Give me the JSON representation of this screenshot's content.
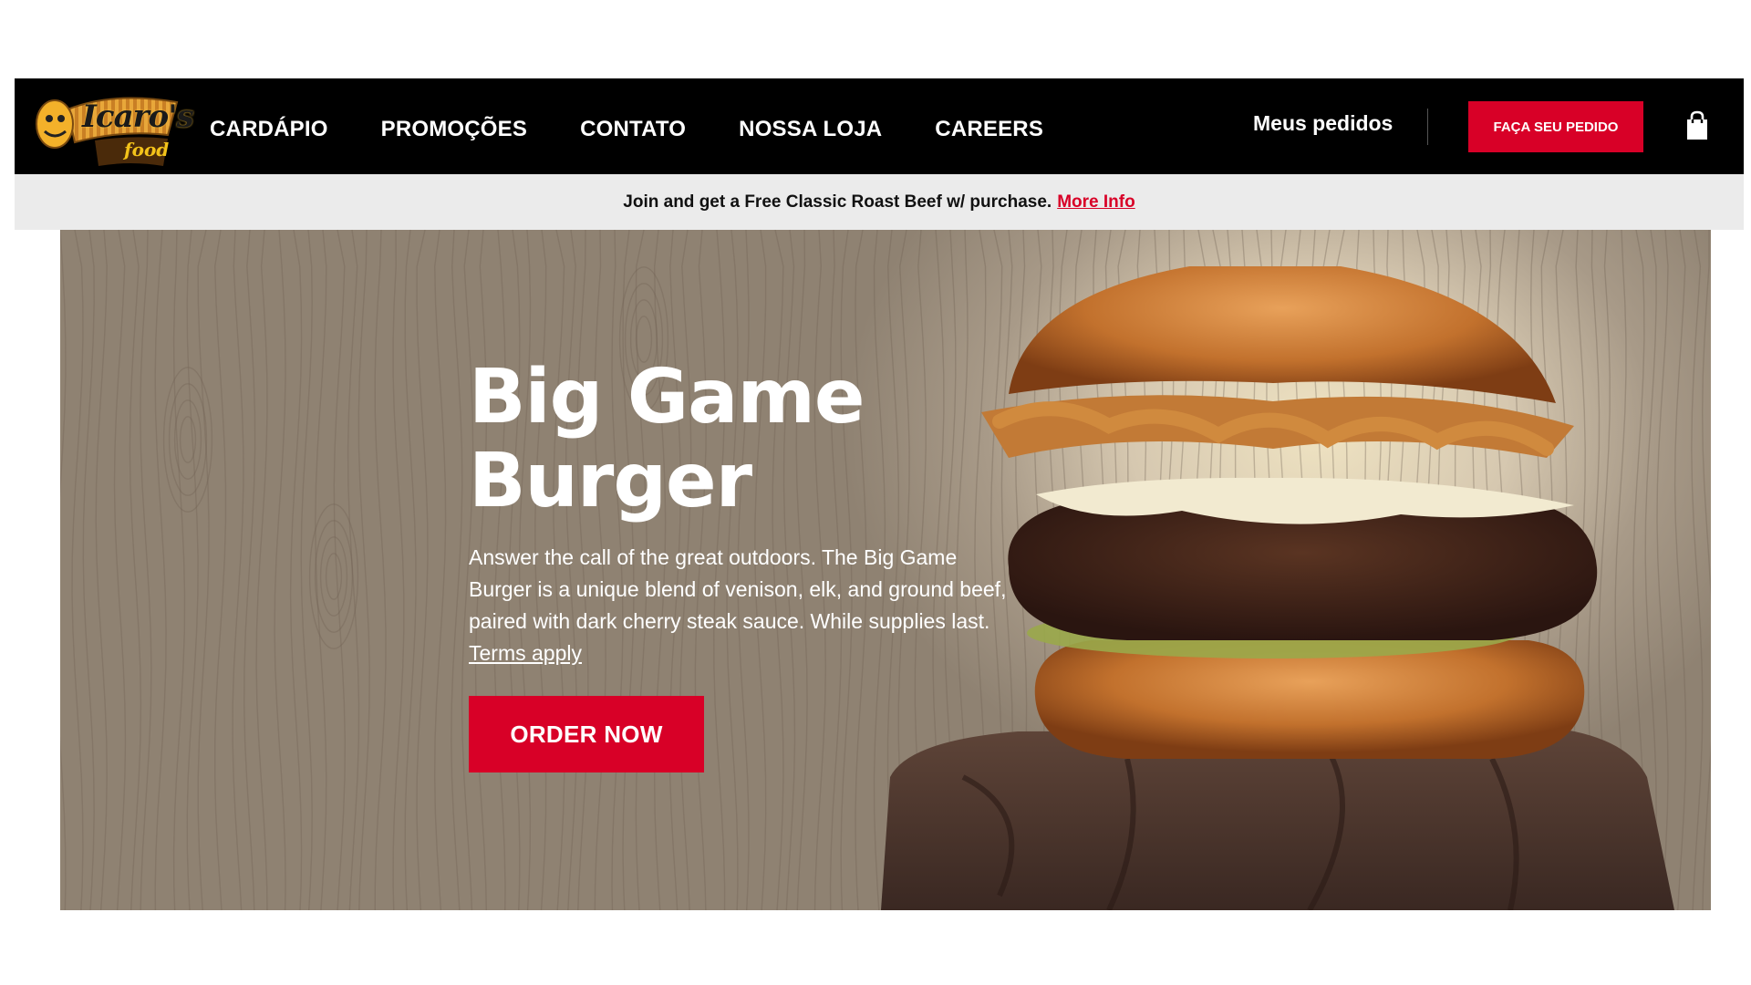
{
  "brand": {
    "logo_text": "Icaro's",
    "logo_sub": "food"
  },
  "nav": {
    "items": [
      {
        "label": "CARDÁPIO"
      },
      {
        "label": "PROMOÇÕES"
      },
      {
        "label": "CONTATO"
      },
      {
        "label": "NOSSA LOJA"
      },
      {
        "label": "CAREERS"
      }
    ],
    "my_orders": "Meus pedidos",
    "cta": "FAÇA SEU PEDIDO",
    "cart_icon": "shopping-bag-icon"
  },
  "promo": {
    "text": "Join and get a Free Classic Roast Beef w/ purchase.",
    "link": "More Info"
  },
  "hero": {
    "title_line1": "Big Game",
    "title_line2": "Burger",
    "description": "Answer the call of the great outdoors. The Big Game Burger is a unique blend of venison, elk, and ground beef, paired with dark cherry steak sauce. While supplies last.",
    "terms": "Terms apply",
    "button": "ORDER NOW"
  },
  "colors": {
    "accent": "#d80027",
    "header_bg": "#000000",
    "promo_bg": "#ebebeb"
  }
}
